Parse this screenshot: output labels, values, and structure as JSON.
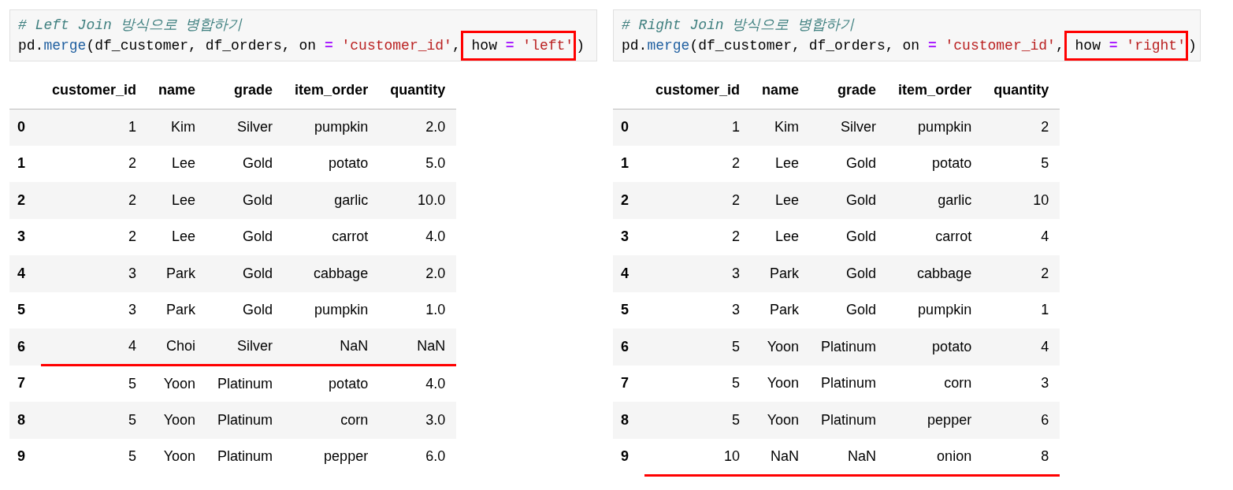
{
  "panels": [
    {
      "code": {
        "comment": "# Left Join 방식으로 병합하기",
        "tokens": [
          {
            "text": "pd.",
            "kind": "plain",
            "boxed": false
          },
          {
            "text": "merge",
            "kind": "function",
            "boxed": false
          },
          {
            "text": "(df_customer, df_orders, on ",
            "kind": "plain",
            "boxed": false
          },
          {
            "text": "=",
            "kind": "operator",
            "boxed": false
          },
          {
            "text": " 'customer_id'",
            "kind": "string",
            "boxed": false
          },
          {
            "text": ",",
            "kind": "plain",
            "boxed": false
          },
          {
            "text": " how ",
            "kind": "plain",
            "boxed": true
          },
          {
            "text": "=",
            "kind": "operator",
            "boxed": true
          },
          {
            "text": " 'left'",
            "kind": "string",
            "boxed": true
          },
          {
            "text": ")",
            "kind": "plain",
            "boxed": false
          }
        ]
      },
      "table": {
        "columns": [
          "customer_id",
          "name",
          "grade",
          "item_order",
          "quantity"
        ],
        "rows": [
          {
            "index": "0",
            "cells": [
              "1",
              "Kim",
              "Silver",
              "pumpkin",
              "2.0"
            ],
            "underlined": false
          },
          {
            "index": "1",
            "cells": [
              "2",
              "Lee",
              "Gold",
              "potato",
              "5.0"
            ],
            "underlined": false
          },
          {
            "index": "2",
            "cells": [
              "2",
              "Lee",
              "Gold",
              "garlic",
              "10.0"
            ],
            "underlined": false
          },
          {
            "index": "3",
            "cells": [
              "2",
              "Lee",
              "Gold",
              "carrot",
              "4.0"
            ],
            "underlined": false
          },
          {
            "index": "4",
            "cells": [
              "3",
              "Park",
              "Gold",
              "cabbage",
              "2.0"
            ],
            "underlined": false
          },
          {
            "index": "5",
            "cells": [
              "3",
              "Park",
              "Gold",
              "pumpkin",
              "1.0"
            ],
            "underlined": false
          },
          {
            "index": "6",
            "cells": [
              "4",
              "Choi",
              "Silver",
              "NaN",
              "NaN"
            ],
            "underlined": true
          },
          {
            "index": "7",
            "cells": [
              "5",
              "Yoon",
              "Platinum",
              "potato",
              "4.0"
            ],
            "underlined": false
          },
          {
            "index": "8",
            "cells": [
              "5",
              "Yoon",
              "Platinum",
              "corn",
              "3.0"
            ],
            "underlined": false
          },
          {
            "index": "9",
            "cells": [
              "5",
              "Yoon",
              "Platinum",
              "pepper",
              "6.0"
            ],
            "underlined": false
          }
        ]
      }
    },
    {
      "code": {
        "comment": "# Right Join 방식으로 병합하기",
        "tokens": [
          {
            "text": "pd.",
            "kind": "plain",
            "boxed": false
          },
          {
            "text": "merge",
            "kind": "function",
            "boxed": false
          },
          {
            "text": "(df_customer, df_orders, on ",
            "kind": "plain",
            "boxed": false
          },
          {
            "text": "=",
            "kind": "operator",
            "boxed": false
          },
          {
            "text": " 'customer_id'",
            "kind": "string",
            "boxed": false
          },
          {
            "text": ",",
            "kind": "plain",
            "boxed": false
          },
          {
            "text": " how ",
            "kind": "plain",
            "boxed": true
          },
          {
            "text": "=",
            "kind": "operator",
            "boxed": true
          },
          {
            "text": " 'right'",
            "kind": "string",
            "boxed": true
          },
          {
            "text": ")",
            "kind": "plain",
            "boxed": false
          }
        ]
      },
      "table": {
        "columns": [
          "customer_id",
          "name",
          "grade",
          "item_order",
          "quantity"
        ],
        "rows": [
          {
            "index": "0",
            "cells": [
              "1",
              "Kim",
              "Silver",
              "pumpkin",
              "2"
            ],
            "underlined": false
          },
          {
            "index": "1",
            "cells": [
              "2",
              "Lee",
              "Gold",
              "potato",
              "5"
            ],
            "underlined": false
          },
          {
            "index": "2",
            "cells": [
              "2",
              "Lee",
              "Gold",
              "garlic",
              "10"
            ],
            "underlined": false
          },
          {
            "index": "3",
            "cells": [
              "2",
              "Lee",
              "Gold",
              "carrot",
              "4"
            ],
            "underlined": false
          },
          {
            "index": "4",
            "cells": [
              "3",
              "Park",
              "Gold",
              "cabbage",
              "2"
            ],
            "underlined": false
          },
          {
            "index": "5",
            "cells": [
              "3",
              "Park",
              "Gold",
              "pumpkin",
              "1"
            ],
            "underlined": false
          },
          {
            "index": "6",
            "cells": [
              "5",
              "Yoon",
              "Platinum",
              "potato",
              "4"
            ],
            "underlined": false
          },
          {
            "index": "7",
            "cells": [
              "5",
              "Yoon",
              "Platinum",
              "corn",
              "3"
            ],
            "underlined": false
          },
          {
            "index": "8",
            "cells": [
              "5",
              "Yoon",
              "Platinum",
              "pepper",
              "6"
            ],
            "underlined": false
          },
          {
            "index": "9",
            "cells": [
              "10",
              "NaN",
              "NaN",
              "onion",
              "8"
            ],
            "underlined": true
          }
        ]
      }
    }
  ]
}
